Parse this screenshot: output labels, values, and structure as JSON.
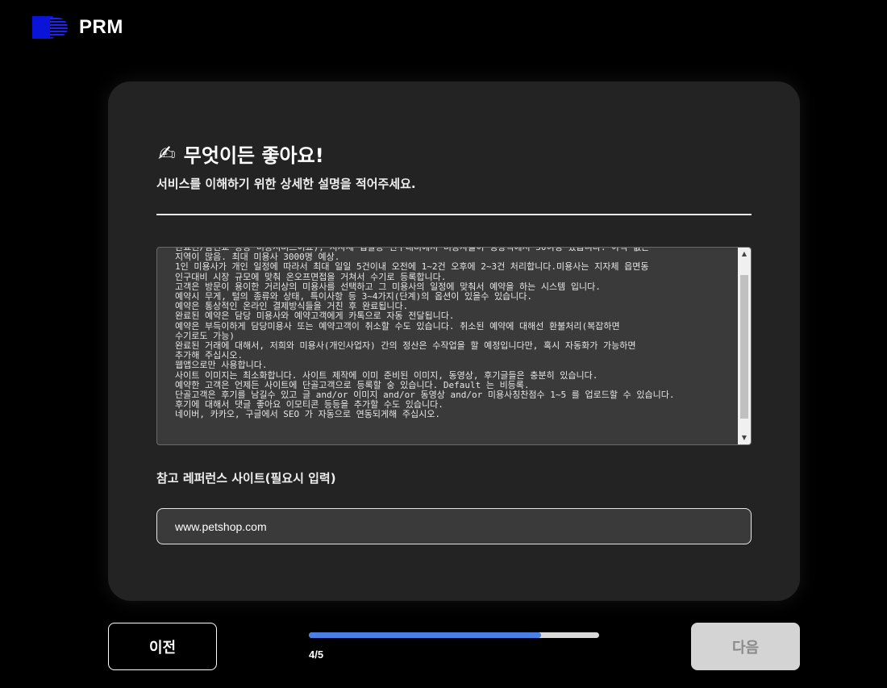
{
  "header": {
    "logo_text": "PRM",
    "logo_icon": "prm-logo-icon",
    "brand_color": "#0a14d9"
  },
  "step": {
    "emoji": "✍",
    "title": "무엇이든 좋아요!",
    "subtitle": "서비스를 이해하기 위한 상세한 설명을 적어주세요."
  },
  "description": {
    "text": "완료된/삼선교 등등 미용서비스이죠), 지자체 입찰등 인구대비에서 미용사들이 영향력에서 30여명 있습니다. 아직 없는\n지역이 많음. 최대 미용사 3000명 예상.\n1인 미용사가 개인 일정에 따라서 최대 일일 5건이내 오전에 1~2건 오후에 2~3건 처리합니다.미용사는 지자체 읍면동\n인구대비 시장 규모에 맞춰 온오프면접을 거쳐서 수기로 등록합니다.\n고객은 방문이 용이한 거리상의 미용사를 선택하고 그 미용사의 일정에 맞춰서 예약을 하는 시스템 입니다.\n예약시 무게, 털의 종류와 상태, 특이사항 등 3~4가지(단계)의 옵션이 있을수 있습니다.\n예약은 통상적인 온라인 결제방식들을 거친 후 완료됩니다.\n완료된 예약은 담당 미용사와 예약고객에게 카톡으로 자동 전달됩니다.\n예약은 부득이하게 담당미용사 또는 예약고객이 취소할 수도 있습니다. 취소된 예약에 대해선 환불처리(복잡하면\n수기로도 가능)\n완료된 거래에 대해서, 저희와 미용사(개인사업자) 간의 정산은 수작업을 할 예정입니다만, 혹시 자동화가 가능하면\n추가해 주십시오.\n웹앱으로만 사용합니다.\n사이트 이미지는 최소화합니다. 사이트 제작에 이미 준비된 이미지, 동영상, 후기글들은 충분히 있습니다.\n예약한 고객은 언제든 사이트에 단골고객으로 등록할 숭 있습니다. Default 는 비등록.\n단골고객은 후기를 남길수 있고 글 and/or 이미지 and/or 동영상 and/or 미용사칭찬점수 1~5 를 업로드할 수 있습니다.\n후기에 대해서 댓글 좋아요 이모티콘 등등을 추가할 수도 있습니다.\n네이버, 카카오, 구글에서 SEO 가 자동으로 연동되게해 주십시오."
  },
  "reference": {
    "label": "참고 레퍼런스 사이트(필요시 입력)",
    "value": "www.petshop.com",
    "placeholder": ""
  },
  "nav": {
    "prev_label": "이전",
    "next_label": "다음",
    "progress_text": "4/5",
    "progress_fraction": 0.8,
    "progress_color": "#4a7fe6"
  }
}
